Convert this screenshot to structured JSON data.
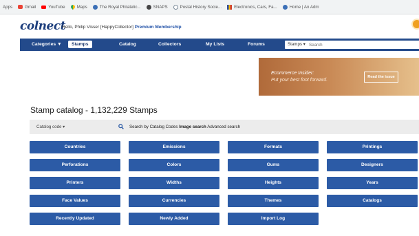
{
  "bookmarks": [
    {
      "icon": "apps-grid-icon",
      "label": "Apps"
    },
    {
      "icon": "gmail-icon",
      "label": "Gmail"
    },
    {
      "icon": "youtube-icon",
      "label": "YouTube"
    },
    {
      "icon": "maps-icon",
      "label": "Maps"
    },
    {
      "icon": "globe-icon",
      "label": "The Royal Philatelic..."
    },
    {
      "icon": "snaps-icon",
      "label": "SNAPS"
    },
    {
      "icon": "postal-icon",
      "label": "Postal History Socie..."
    },
    {
      "icon": "bars-icon",
      "label": "Electronics, Cars, Fa..."
    },
    {
      "icon": "globe-icon",
      "label": "Home | An Adm"
    }
  ],
  "header": {
    "logo": "colnect",
    "greeting": "Hello, Philip Visser [HappyCollector]",
    "membership": "Premium Membership"
  },
  "nav": {
    "items": [
      "Categories ▼",
      "Stamps",
      "Catalog",
      "Collectors",
      "My Lists",
      "Forums"
    ],
    "active": "Stamps",
    "scope": "Stamps ▾",
    "search_placeholder": "Search"
  },
  "promo": {
    "heading": "Ecommerce Insider:",
    "subheading": "Put your best foot forward.",
    "button": "Read the issue"
  },
  "catalog": {
    "title": "Stamp catalog - 1,132,229 Stamps",
    "code_select": "Catalog code  ▾",
    "link_search_by_codes": "Search by Catalog Codes",
    "link_image_search": "Image search",
    "link_advanced": "Advanced search",
    "buttons": [
      "Countries",
      "Emissions",
      "Formats",
      "Printings",
      "Perforations",
      "Colors",
      "Gums",
      "Designers",
      "Printers",
      "Widths",
      "Heights",
      "Years",
      "Face Values",
      "Currencies",
      "Themes",
      "Catalogs",
      "Recently Updated",
      "Newly Added",
      "Import Log"
    ]
  },
  "colors": {
    "nav": "#234a8b",
    "button": "#2c5ba6",
    "promo_left": "#b06a3a",
    "promo_right": "#e6c08c"
  }
}
